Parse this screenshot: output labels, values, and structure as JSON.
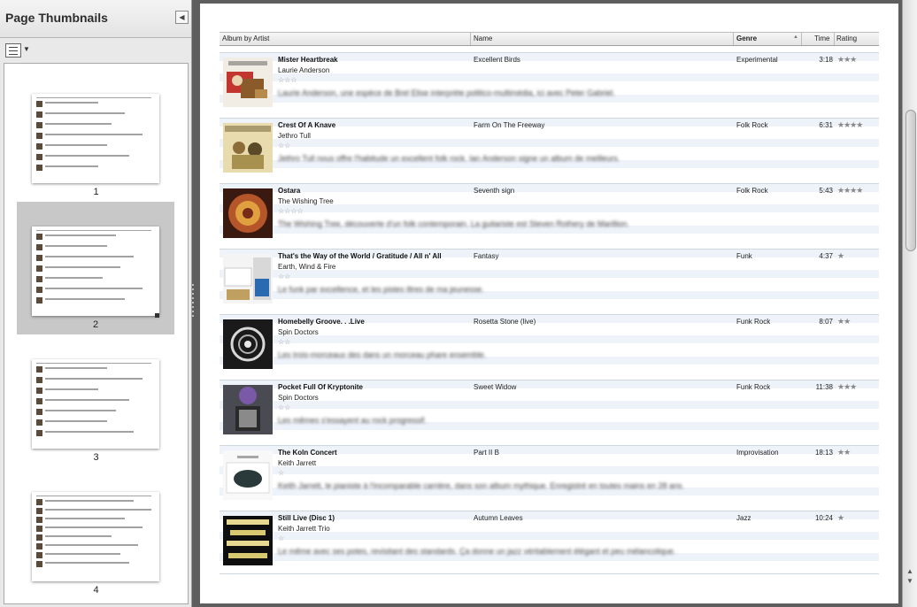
{
  "sidebar": {
    "title": "Page Thumbnails",
    "collapse_icon": "collapse-left-icon",
    "view_icon": "thumbnail-view-menu-icon",
    "thumbnails": [
      {
        "label": "1"
      },
      {
        "label": "2"
      },
      {
        "label": "3"
      },
      {
        "label": "4"
      }
    ]
  },
  "table": {
    "columns": {
      "album_by_artist": "Album by Artist",
      "name": "Name",
      "genre": "Genre",
      "time": "Time",
      "rating": "Rating"
    },
    "rows": [
      {
        "album": "Mister Heartbreak",
        "artist": "Laurie Anderson",
        "stars": "☆☆☆",
        "comment": "Laurie Anderson, une espèce de Brel Elise interprète politico-multimédia, ici avec Peter Gabriel.",
        "name": "Excellent Birds",
        "genre": "Experimental",
        "time": "3:18",
        "rating": "★★★"
      },
      {
        "album": "Crest Of A Knave",
        "artist": "Jethro Tull",
        "stars": "☆☆",
        "comment": "Jethro Tull nous offre l'habitude un excellent folk rock. Ian Anderson signe un album de meilleurs.",
        "name": "Farm On The Freeway",
        "genre": "Folk Rock",
        "time": "6:31",
        "rating": "★★★★"
      },
      {
        "album": "Ostara",
        "artist": "The Wishing Tree",
        "stars": "☆☆☆☆",
        "comment": "The Wishing Tree, découverte d'un folk contemporain. La guitariste est Steven Rothery de Marillion.",
        "name": "Seventh sign",
        "genre": "Folk Rock",
        "time": "5:43",
        "rating": "★★★★"
      },
      {
        "album": "That's the Way of the World / Gratitude / All n' All",
        "artist": "Earth, Wind & Fire",
        "stars": "☆☆",
        "comment": "Le funk par excellence, et les pistes iltres de ma jeunesse.",
        "name": "Fantasy",
        "genre": "Funk",
        "time": "4:37",
        "rating": "★"
      },
      {
        "album": "Homebelly Groove. . .Live",
        "artist": "Spin Doctors",
        "stars": "☆☆",
        "comment": "Les trois-morceaux des dans un morceau phare ensemble.",
        "name": "Rosetta Stone (live)",
        "genre": "Funk Rock",
        "time": "8:07",
        "rating": "★★"
      },
      {
        "album": "Pocket Full Of Kryptonite",
        "artist": "Spin Doctors",
        "stars": "☆☆",
        "comment": "Les mêmes s'essayent au rock progressif.",
        "name": "Sweet Widow",
        "genre": "Funk Rock",
        "time": "11:38",
        "rating": "★★★"
      },
      {
        "album": "The Koln Concert",
        "artist": "Keith Jarrett",
        "stars": "☆",
        "comment": "Keith Jarrett, le pianiste à l'incomparable carrière, dans son album mythique. Enregistré en toutes mains en 28 ans.",
        "name": "Part II B",
        "genre": "Improvisation",
        "time": "18:13",
        "rating": "★★"
      },
      {
        "album": "Still Live (Disc 1)",
        "artist": "Keith Jarrett Trio",
        "stars": "☆",
        "comment": "Le même avec ses potes, revisitant des standards. Ça donne un jazz véritablement élégant et peu mélancolique.",
        "name": "Autumn Leaves",
        "genre": "Jazz",
        "time": "10:24",
        "rating": "★"
      }
    ]
  },
  "scrollbar": {
    "up_icon": "scroll-up-icon",
    "down_icon": "scroll-down-icon"
  },
  "colors": {
    "sidebar_bg": "#e9e9e9",
    "window_bg": "#5e5e5e",
    "row_stripe": "#eef3fa",
    "selected_thumb": "#c8c8c8"
  }
}
